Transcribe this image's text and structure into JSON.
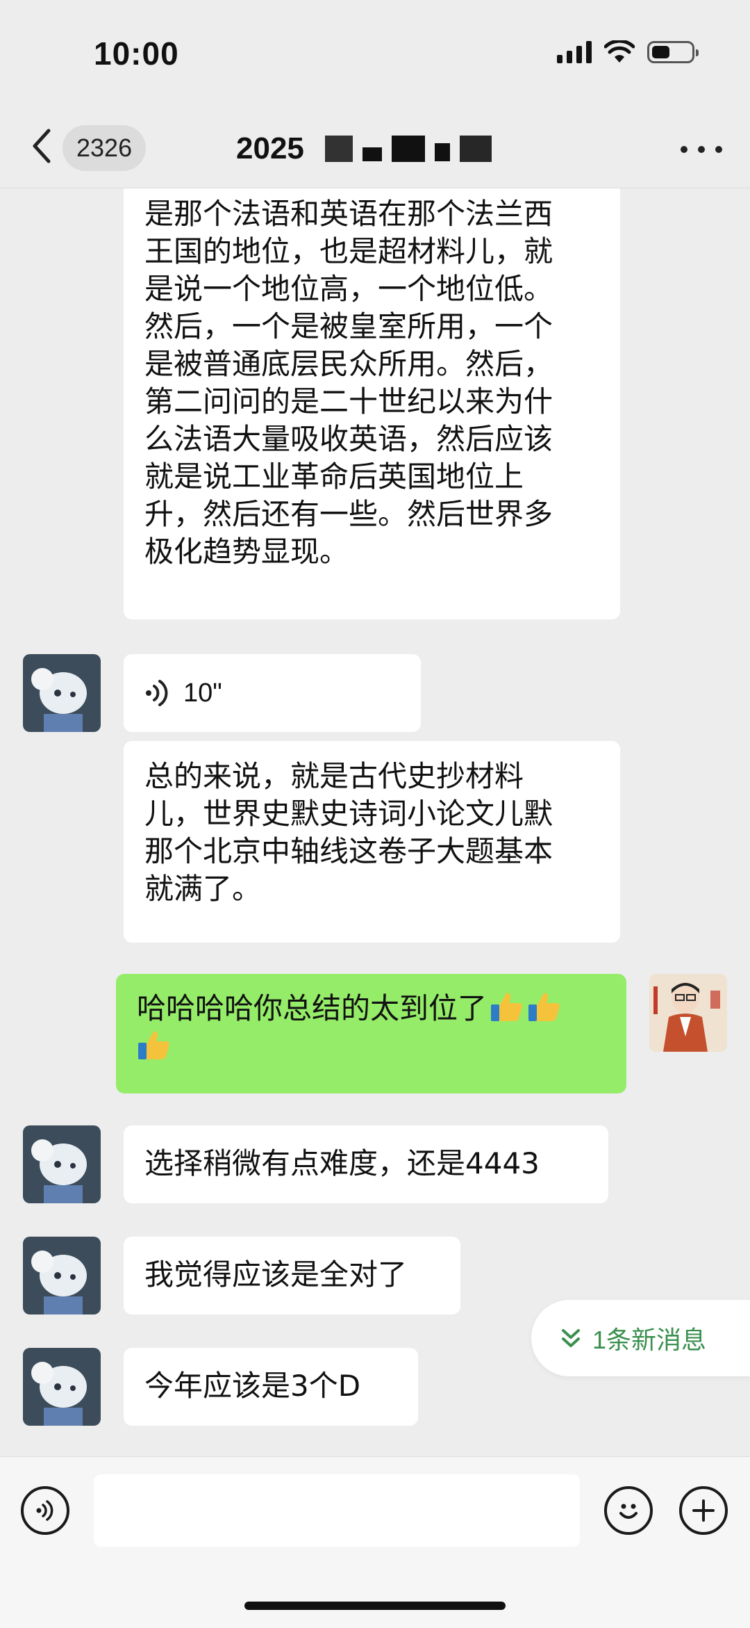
{
  "status_bar": {
    "time": "10:00",
    "icons": [
      "signal-icon",
      "wifi-icon",
      "battery-icon"
    ]
  },
  "nav": {
    "back_icon": "chevron-left-icon",
    "unread_count": "2326",
    "title_visible": "2025",
    "more_icon": "more-icon"
  },
  "messages": [
    {
      "side": "left",
      "type": "text",
      "text": "是那个法语和英语在那个法兰西\n王国的地位，也是超材料儿，就\n是说一个地位高，一个地位低。\n然后，一个是被皇室所用，一个\n是被普通底层民众所用。然后，\n第二问问的是二十世纪以来为什\n么法语大量吸收英语，然后应该\n就是说工业革命后英国地位上\n升，然后还有一些。然后世界多\n极化趋势显现。"
    },
    {
      "side": "left",
      "type": "voice",
      "duration": "10\""
    },
    {
      "side": "left",
      "type": "text",
      "text": "总的来说，就是古代史抄材料\n儿，世界史默史诗词小论文儿默\n那个北京中轴线这卷子大题基本\n就满了。"
    },
    {
      "side": "right",
      "type": "text",
      "text": "哈哈哈哈你总结的太到位了",
      "emoji": [
        "thumbs-up",
        "thumbs-up",
        "thumbs-up"
      ]
    },
    {
      "side": "left",
      "type": "text",
      "text": "选择稍微有点难度，还是4443"
    },
    {
      "side": "left",
      "type": "text",
      "text": "我觉得应该是全对了"
    },
    {
      "side": "left",
      "type": "text",
      "text": "今年应该是3个D"
    }
  ],
  "new_messages_pill": {
    "label": "1条新消息",
    "icon": "double-chevron-down-icon"
  },
  "input_bar": {
    "voice_icon": "voice-input-icon",
    "placeholder": "",
    "emoji_icon": "emoji-icon",
    "plus_icon": "plus-icon"
  },
  "colors": {
    "background": "#ededed",
    "bubble_in": "#ffffff",
    "bubble_out": "#95ec69",
    "accent_green": "#3a8f4e"
  }
}
